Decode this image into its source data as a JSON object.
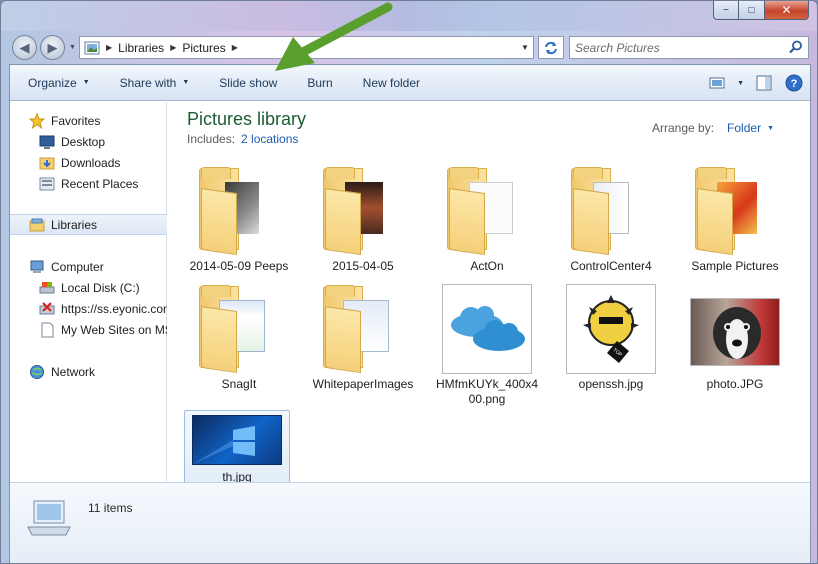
{
  "window": {
    "buttons": {
      "minimize": "−",
      "maximize": "□",
      "close": "✕"
    }
  },
  "address": {
    "crumbs": [
      "Libraries",
      "Pictures"
    ],
    "search_placeholder": "Search Pictures"
  },
  "toolbar": {
    "organize": "Organize",
    "share_with": "Share with",
    "slide_show": "Slide show",
    "burn": "Burn",
    "new_folder": "New folder"
  },
  "nav": {
    "favorites": "Favorites",
    "desktop": "Desktop",
    "downloads": "Downloads",
    "recent_places": "Recent Places",
    "libraries": "Libraries",
    "computer": "Computer",
    "local_disk": "Local Disk (C:)",
    "ss_eyonic": "https://ss.eyonic.com",
    "my_web_sites": "My Web Sites on MSN",
    "network": "Network"
  },
  "library": {
    "title": "Pictures library",
    "includes_label": "Includes:",
    "includes_link": "2 locations",
    "arrange_label": "Arrange by:",
    "arrange_value": "Folder"
  },
  "items": [
    {
      "label": "2014-05-09 Peeps",
      "kind": "folder"
    },
    {
      "label": "2015-04-05",
      "kind": "folder"
    },
    {
      "label": "ActOn",
      "kind": "folder"
    },
    {
      "label": "ControlCenter4",
      "kind": "folder"
    },
    {
      "label": "Sample Pictures",
      "kind": "folder"
    },
    {
      "label": "SnagIt",
      "kind": "folder"
    },
    {
      "label": "WhitepaperImages",
      "kind": "folder"
    },
    {
      "label": "HMfmKUYk_400x400.png",
      "kind": "image"
    },
    {
      "label": "openssh.jpg",
      "kind": "image"
    },
    {
      "label": "photo.JPG",
      "kind": "image"
    },
    {
      "label": "th.jpg",
      "kind": "image"
    }
  ],
  "details": {
    "count": "11 items"
  },
  "colors": {
    "library_title": "#1e5c34",
    "link": "#1a5cb0",
    "arrow": "#5a9e2e"
  }
}
